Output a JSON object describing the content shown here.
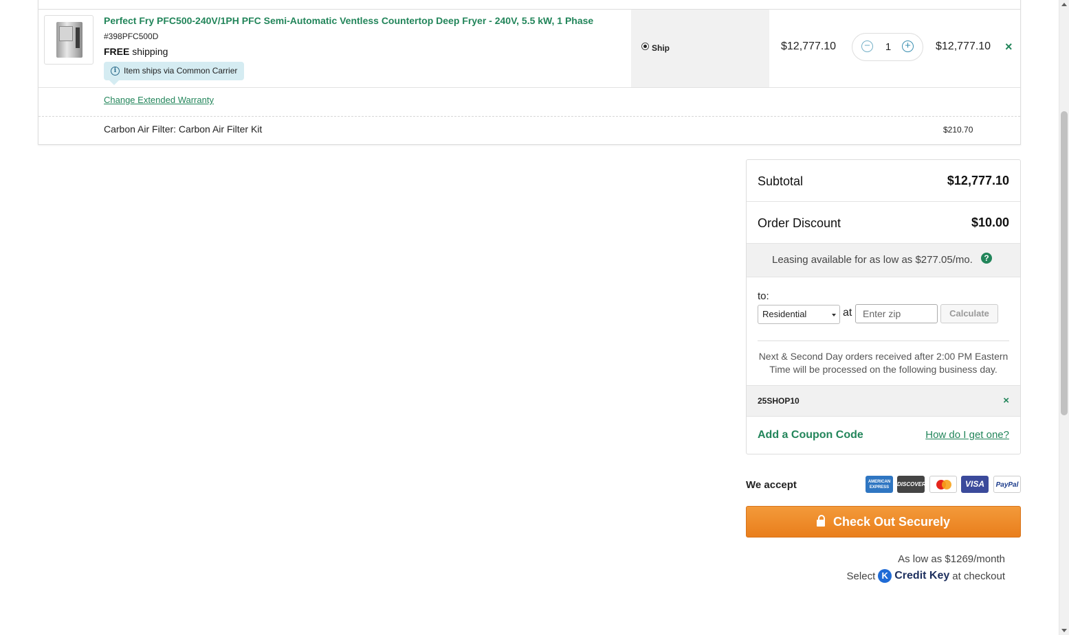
{
  "cart_item": {
    "name": "Perfect Fry PFC500-240V/1PH PFC Semi-Automatic Ventless Countertop Deep Fryer - 240V, 5.5 kW, 1 Phase",
    "sku": "#398PFC500D",
    "shipping_bold": "FREE",
    "shipping_rest": "shipping",
    "carrier_note": "Item ships via Common Carrier",
    "ship_option": "Ship",
    "unit_price": "$12,777.10",
    "quantity": "1",
    "total": "$12,777.10",
    "remove_glyph": "×",
    "warranty_link": "Change Extended Warranty",
    "accessory": "Carbon Air Filter: Carbon Air Filter Kit",
    "accessory_price": "$210.70"
  },
  "summary": {
    "subtotal_label": "Subtotal",
    "subtotal_value": "$12,777.10",
    "discount_label": "Order Discount",
    "discount_value": "$10.00",
    "leasing": "Leasing available for as low as $277.05/mo.",
    "help_glyph": "?",
    "to_label": "to:",
    "address_type": "Residential",
    "at_label": "at",
    "zip_placeholder": "Enter zip",
    "calculate": "Calculate",
    "notice": "Next & Second Day orders received after 2:00 PM Eastern Time will be processed on the following business day.",
    "coupon_code": "25SHOP10",
    "coupon_remove": "×",
    "add_coupon": "Add a Coupon Code",
    "how_get": "How do I get one?"
  },
  "payment": {
    "we_accept": "We accept",
    "amex": "AMERICAN EXPRESS",
    "discover": "DISCOVER",
    "visa": "VISA",
    "paypal": "PayPal"
  },
  "checkout": {
    "label": "Check Out Securely",
    "as_low": "As low as $1269/month",
    "select": "Select",
    "credit_key": "Credit Key",
    "at_checkout": "at checkout",
    "ck_glyph": "K"
  },
  "icons": {
    "info": "info-icon",
    "lock": "lock-icon",
    "help": "question-icon",
    "credit_key": "credit-key-icon"
  },
  "colors": {
    "brand_green": "#22855a",
    "checkout_orange": "#ef8a2a",
    "info_bg": "#d5ecf2"
  }
}
